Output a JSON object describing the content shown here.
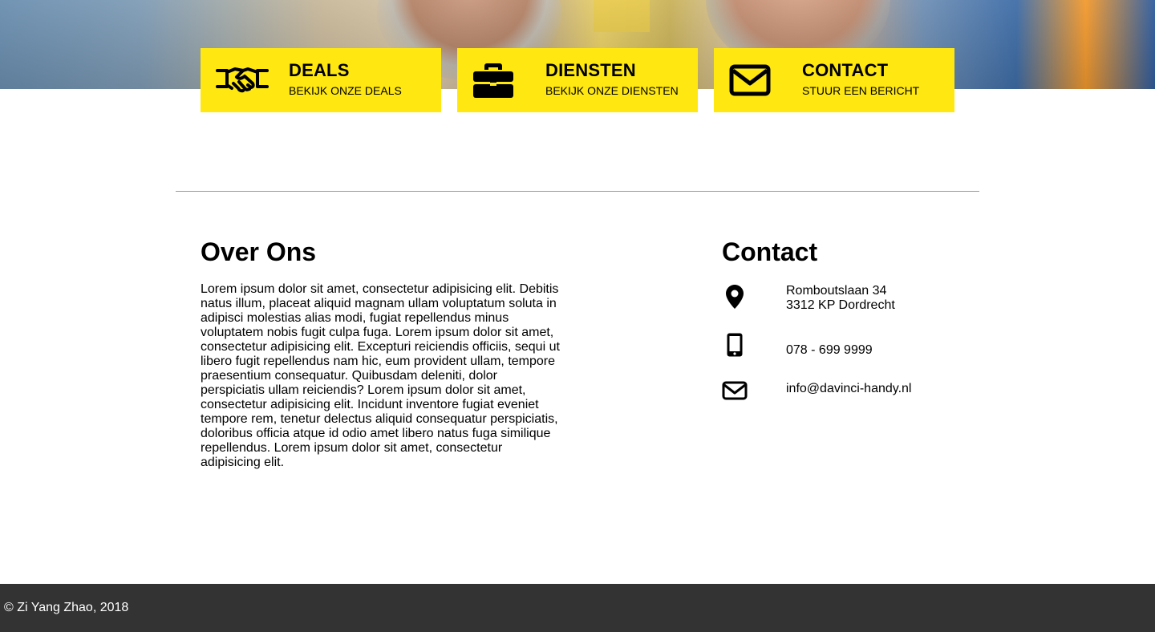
{
  "cards": [
    {
      "title": "DEALS",
      "subtitle": "BEKIJK ONZE DEALS",
      "icon": "handshake-icon"
    },
    {
      "title": "DIENSTEN",
      "subtitle": "BEKIJK ONZE DIENSTEN",
      "icon": "briefcase-icon"
    },
    {
      "title": "CONTACT",
      "subtitle": "STUUR EEN BERICHT",
      "icon": "envelope-icon"
    }
  ],
  "about": {
    "heading": "Over Ons",
    "text": "Lorem ipsum dolor sit amet, consectetur adipisicing elit. Debitis natus illum, placeat aliquid magnam ullam voluptatum soluta in adipisci molestias alias modi, fugiat repellendus minus voluptatem nobis fugit culpa fuga. Lorem ipsum dolor sit amet, consectetur adipisicing elit. Excepturi reiciendis officiis, sequi ut libero fugit repellendus nam hic, eum provident ullam, tempore praesentium consequatur. Quibusdam deleniti, dolor perspiciatis ullam reiciendis? Lorem ipsum dolor sit amet, consectetur adipisicing elit. Incidunt inventore fugiat eveniet tempore rem, tenetur delectus aliquid consequatur perspiciatis, doloribus officia atque id odio amet libero natus fuga similique repellendus. Lorem ipsum dolor sit amet, consectetur adipisicing elit."
  },
  "contact": {
    "heading": "Contact",
    "address_line1": "Romboutslaan 34",
    "address_line2": "3312 KP Dordrecht",
    "phone": "078 - 699 9999",
    "email": "info@davinci-handy.nl"
  },
  "footer": {
    "copyright": "© Zi Yang Zhao, 2018"
  },
  "colors": {
    "accent": "#ffe811",
    "footer_bg": "#333333",
    "divider": "#999999"
  }
}
